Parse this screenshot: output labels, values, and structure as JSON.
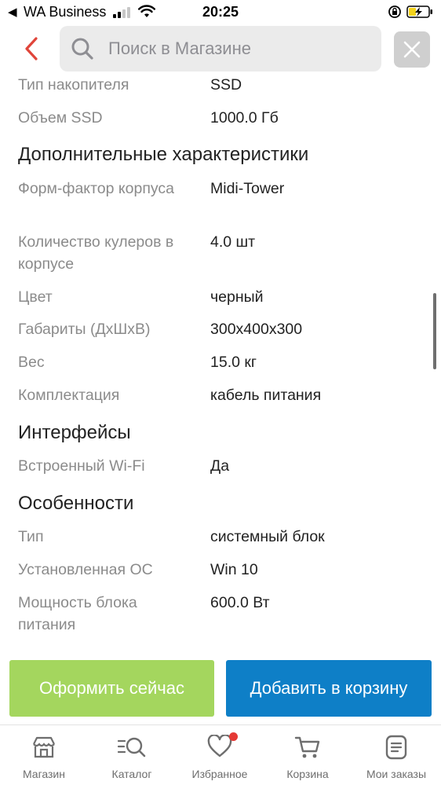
{
  "status_bar": {
    "back_glyph": "◀",
    "app_name": "WA Business",
    "time": "20:25"
  },
  "header": {
    "back_icon": "chevron-left-icon",
    "search_placeholder": "Поиск в Магазине",
    "close_icon": "close-icon"
  },
  "specs": [
    {
      "label": "Тип накопителя",
      "value": "SSD"
    },
    {
      "label": "Объем SSD",
      "value": "1000.0 Гб"
    }
  ],
  "sections": [
    {
      "title": "Дополнительные характеристики",
      "rows": [
        {
          "label": "Форм-фактор корпуса",
          "value": "Midi-Tower"
        },
        {
          "label": "Количество кулеров в корпусе",
          "value": "4.0 шт"
        },
        {
          "label": "Цвет",
          "value": "черный"
        },
        {
          "label": "Габариты (ДхШхВ)",
          "value": "300x400x300"
        },
        {
          "label": "Вес",
          "value": "15.0 кг"
        },
        {
          "label": "Комплектация",
          "value": "кабель питания"
        }
      ]
    },
    {
      "title": "Интерфейсы",
      "rows": [
        {
          "label": "Встроенный Wi-Fi",
          "value": "Да"
        }
      ]
    },
    {
      "title": "Особенности",
      "rows": [
        {
          "label": "Тип",
          "value": "системный блок"
        },
        {
          "label": "Установленная ОС",
          "value": "Win 10"
        },
        {
          "label": "Мощность блока питания",
          "value": "600.0 Вт"
        }
      ]
    }
  ],
  "actions": {
    "buy_now": "Оформить сейчас",
    "add_to_cart": "Добавить в корзину"
  },
  "tabs": [
    {
      "label": "Магазин",
      "icon": "store-icon"
    },
    {
      "label": "Каталог",
      "icon": "catalog-search-icon"
    },
    {
      "label": "Избранное",
      "icon": "heart-icon"
    },
    {
      "label": "Корзина",
      "icon": "cart-icon"
    },
    {
      "label": "Мои заказы",
      "icon": "orders-icon"
    }
  ],
  "colors": {
    "accent_green": "#a4d65e",
    "accent_blue": "#0e7fc7",
    "back_arrow_red": "#e0453a",
    "notification_dot": "#e53935"
  }
}
